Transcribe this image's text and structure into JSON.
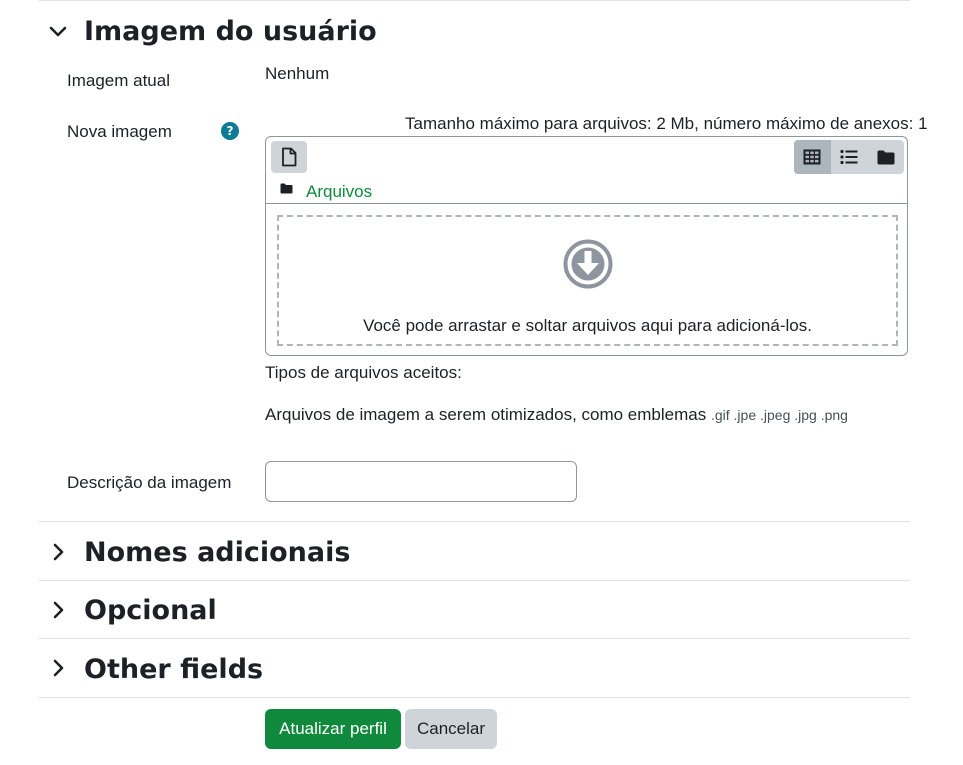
{
  "sections": {
    "user_image": {
      "title": "Imagem do usuário",
      "expanded": true,
      "icon": "chevron-down-icon"
    },
    "additional_names": {
      "title": "Nomes adicionais",
      "expanded": false,
      "icon": "chevron-right-icon"
    },
    "optional": {
      "title": "Opcional",
      "expanded": false,
      "icon": "chevron-right-icon"
    },
    "other_fields": {
      "title": "Other fields",
      "expanded": false,
      "icon": "chevron-right-icon"
    }
  },
  "current_image": {
    "label": "Imagem atual",
    "value": "Nenhum"
  },
  "new_image": {
    "label": "Nova imagem",
    "help_icon": "question-circle-icon",
    "help_glyph": "?",
    "limits_text": "Tamanho máximo para arquivos: 2 Mb, número máximo de anexos: 1",
    "filemanager": {
      "add_icon": "file-icon",
      "view_icons": [
        "grid-icon",
        "list-icon",
        "folder-icon"
      ],
      "path_label": "Arquivos",
      "dropzone_text": "Você pode arrastar e soltar arquivos aqui para adicioná-los."
    },
    "accepted_types_label": "Tipos de arquivos aceitos:",
    "accepted_types_desc": "Arquivos de imagem a serem otimizados, como emblemas",
    "accepted_types_ext": ".gif .jpe .jpeg .jpg .png"
  },
  "image_description": {
    "label": "Descrição da imagem",
    "value": "",
    "placeholder": ""
  },
  "buttons": {
    "submit": "Atualizar perfil",
    "cancel": "Cancelar"
  },
  "colors": {
    "primary": "#0f8a3c",
    "secondary": "#ced4da",
    "help": "#0c7b93",
    "text": "#1d2125"
  }
}
